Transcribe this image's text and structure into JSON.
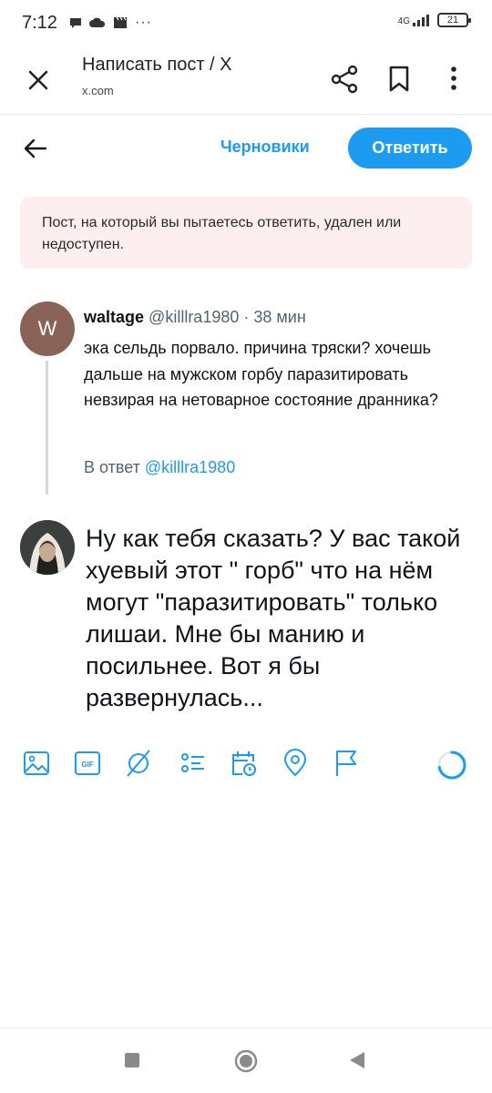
{
  "status_bar": {
    "time": "7:12",
    "ellipsis": "···",
    "network": "4G",
    "battery": "21"
  },
  "browser": {
    "title": "Написать пост / X",
    "url": "x.com"
  },
  "compose": {
    "drafts_label": "Черновики",
    "reply_button_label": "Ответить"
  },
  "notice": {
    "text": "Пост, на который вы пытаетесь ответить, удален или недоступен."
  },
  "original_tweet": {
    "avatar_letter": "W",
    "author_name": "waltage",
    "author_handle": "@killlra1980",
    "separator": " · ",
    "time_ago": "38 мин",
    "text": "эка сельдь порвало. причина тряски? хочешь дальше на мужском горбу паразитировать невзирая на нетоварное состояние дранника?",
    "reply_to_prefix": "В ответ ",
    "reply_to_handle": "@killlra1980"
  },
  "my_reply": {
    "text": "Ну как тебя сказать? У вас такой хуевый этот \" горб\" что на нём могут \"паразитировать\" только лишаи. Мне бы манию и посильнее. Вот я бы развернулась..."
  },
  "toolbar": {
    "icons": [
      "image-icon",
      "gif-icon",
      "grok-icon",
      "poll-icon",
      "schedule-icon",
      "location-icon",
      "flag-icon"
    ],
    "accent_color": "#1d9bf0",
    "char_progress": 0.72
  },
  "colors": {
    "accent": "#1d9bf0",
    "notice_bg": "#fdeef0",
    "avatar_w": "#8a6257"
  }
}
